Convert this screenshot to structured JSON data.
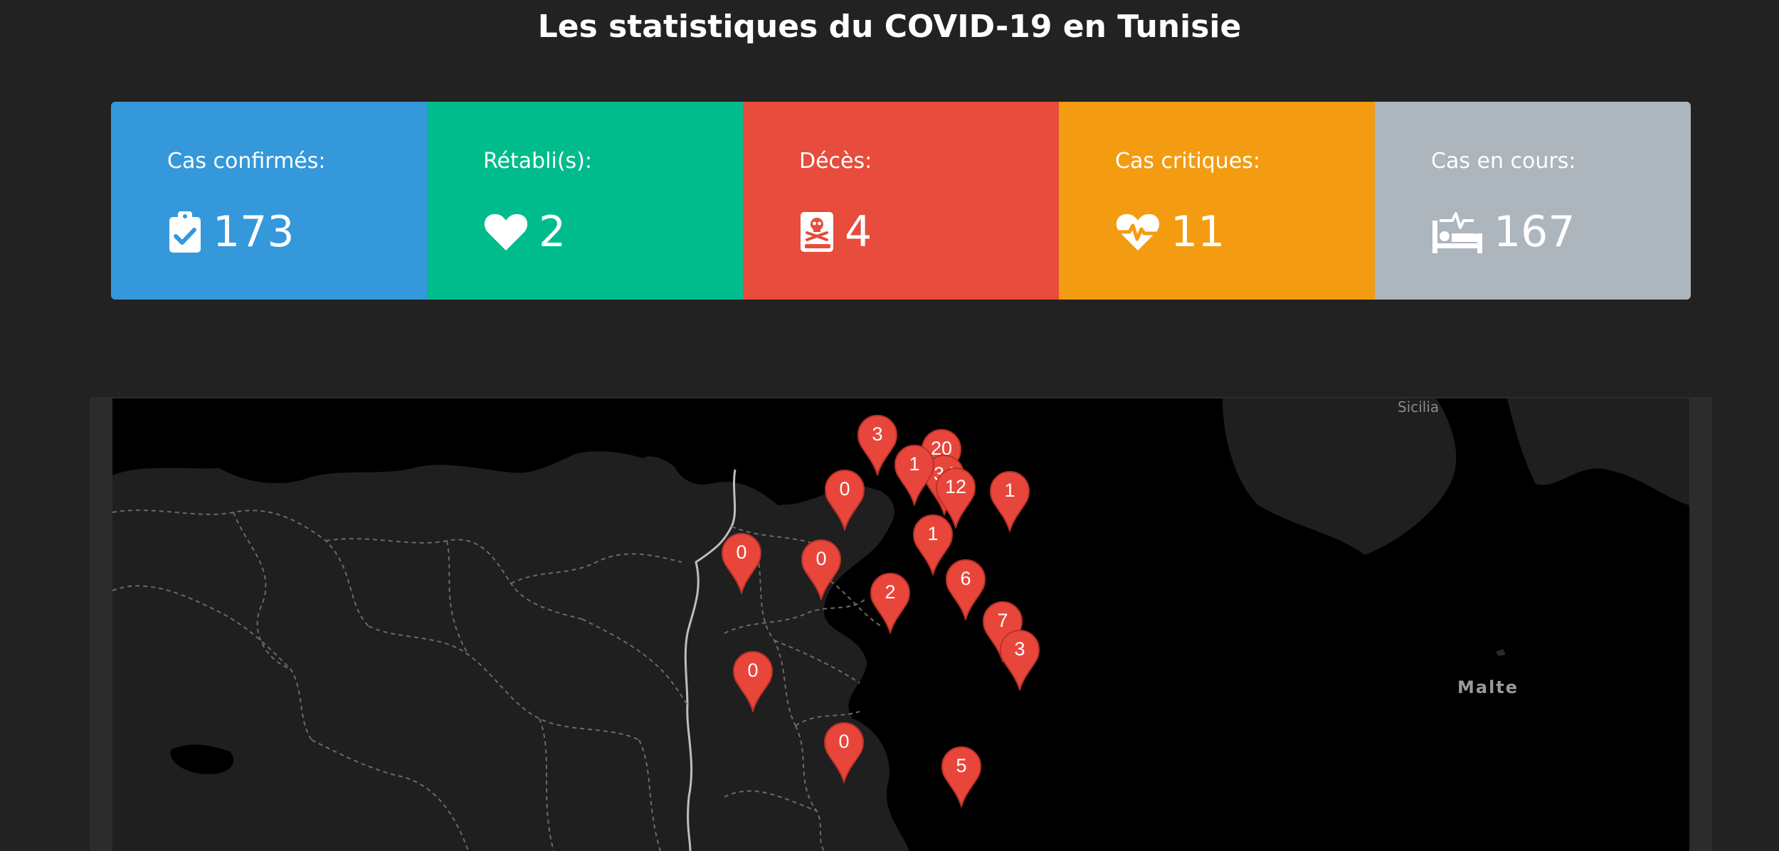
{
  "page": {
    "title": "Les statistiques du COVID-19 en Tunisie"
  },
  "stats": [
    {
      "label": "Cas confirmés:",
      "value": "173",
      "icon": "clipboard-check-icon",
      "color": "#3498db"
    },
    {
      "label": "Rétabli(s):",
      "value": "2",
      "icon": "heart-icon",
      "color": "#00bc8c"
    },
    {
      "label": "Décès:",
      "value": "4",
      "icon": "skull-book-icon",
      "color": "#e74c3c"
    },
    {
      "label": "Cas critiques:",
      "value": "11",
      "icon": "heartbeat-icon",
      "color": "#f39c12"
    },
    {
      "label": "Cas en cours:",
      "value": "167",
      "icon": "bed-icon",
      "color": "#adb5bd"
    }
  ],
  "map": {
    "labels": {
      "sicilia": "Sicilia",
      "malte": "Malte"
    },
    "marker_color": "#e9463b",
    "markers": [
      {
        "count": "3"
      },
      {
        "count": "20"
      },
      {
        "count": "34"
      },
      {
        "count": "1"
      },
      {
        "count": "12"
      },
      {
        "count": "1"
      },
      {
        "count": "0"
      },
      {
        "count": "1"
      },
      {
        "count": "0"
      },
      {
        "count": "0"
      },
      {
        "count": "6"
      },
      {
        "count": "2"
      },
      {
        "count": "7"
      },
      {
        "count": "3"
      },
      {
        "count": "0"
      },
      {
        "count": "0"
      },
      {
        "count": "5"
      }
    ]
  }
}
